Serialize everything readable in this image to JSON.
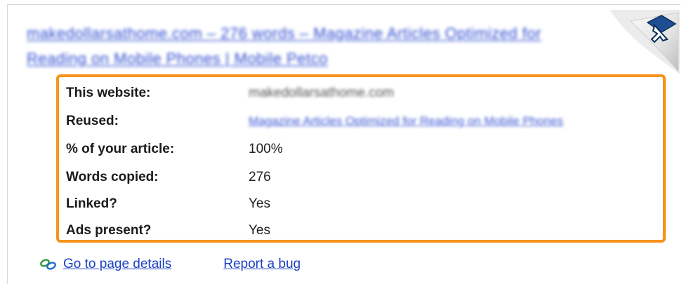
{
  "title": "makedollarsathome.com – 276 words – Magazine Articles Optimized for Reading on Mobile Phones | Mobile Petco",
  "details": {
    "rows": [
      {
        "label": "This website:",
        "value": "makedollarsathome.com"
      },
      {
        "label": "Reused:",
        "value": "Magazine Articles Optimized for Reading on Mobile Phones"
      },
      {
        "label": "% of your article:",
        "value": "100%"
      },
      {
        "label": "Words copied:",
        "value": "276"
      },
      {
        "label": "Linked?",
        "value": "Yes"
      },
      {
        "label": "Ads present?",
        "value": "Yes"
      }
    ]
  },
  "footer": {
    "page_details": "Go to page details",
    "report_bug": "Report a bug"
  },
  "colors": {
    "highlight_border": "#f7941d",
    "link": "#1b3fc2"
  },
  "icons": {
    "page_details": "link-chain-icon",
    "corner": "page-curl-cursor-icon"
  }
}
